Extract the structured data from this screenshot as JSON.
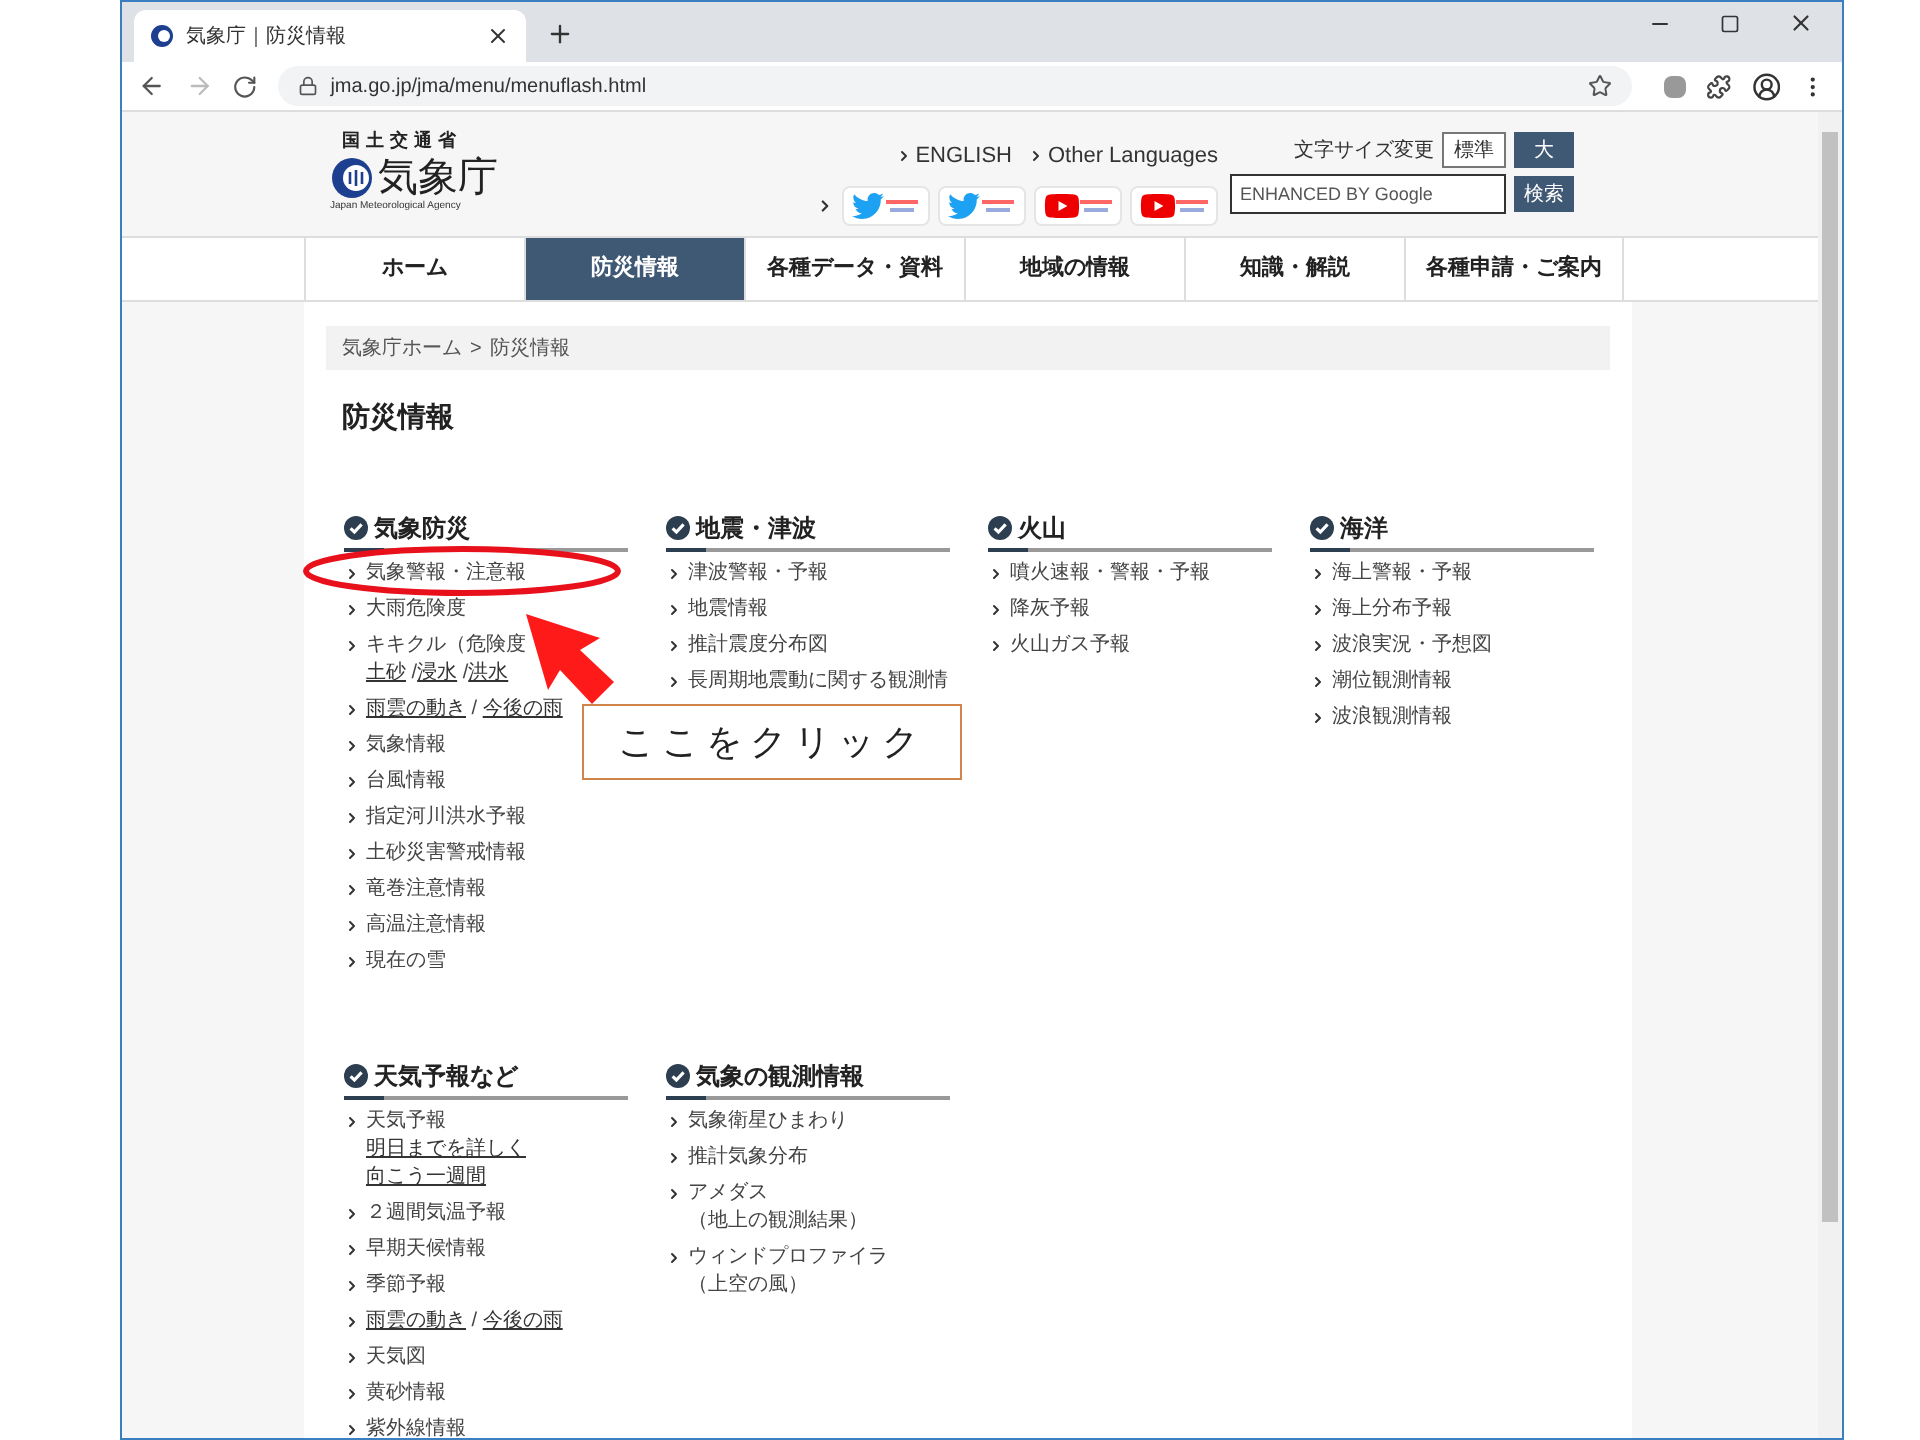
{
  "browser": {
    "tab_title": "気象庁｜防災情報",
    "url": "jma.go.jp/jma/menu/menuflash.html"
  },
  "header": {
    "ministry": "国土交通省",
    "logo": "気象庁",
    "logo_sub": "Japan Meteorological Agency",
    "lang_links": [
      "ENGLISH",
      "Other Languages"
    ],
    "social": [
      {
        "kind": "twitter"
      },
      {
        "kind": "twitter"
      },
      {
        "kind": "youtube"
      },
      {
        "kind": "youtube"
      }
    ],
    "font_size_label": "文字サイズ変更",
    "font_sizes": [
      {
        "label": "標準",
        "selected": false
      },
      {
        "label": "大",
        "selected": true
      }
    ],
    "search": {
      "placeholder": "ENHANCED BY Google",
      "button": "検索"
    }
  },
  "nav": [
    {
      "label": "ホーム",
      "selected": false
    },
    {
      "label": "防災情報",
      "selected": true
    },
    {
      "label": "各種データ・資料",
      "selected": false
    },
    {
      "label": "地域の情報",
      "selected": false
    },
    {
      "label": "知識・解説",
      "selected": false
    },
    {
      "label": "各種申請・ご案内",
      "selected": false
    }
  ],
  "breadcrumb": {
    "items": [
      "気象庁ホーム",
      "防災情報"
    ],
    "separator": ">"
  },
  "title": "防災情報",
  "section_rows": [
    [
      {
        "title": "気象防災",
        "items": [
          [
            [
              {
                "text": "気象警報・注意報"
              }
            ]
          ],
          [
            [
              {
                "text": "大雨危険度"
              }
            ]
          ],
          [
            [
              {
                "text": "キキクル（危険度"
              }
            ],
            [
              {
                "text": "土砂",
                "link": true
              },
              {
                "text": " /"
              },
              {
                "text": "浸水",
                "link": true
              },
              {
                "text": " /"
              },
              {
                "text": "洪水",
                "link": true
              }
            ]
          ],
          [
            [
              {
                "text": "雨雲の動き",
                "link": true
              },
              {
                "text": " / "
              },
              {
                "text": "今後の雨",
                "link": true
              }
            ]
          ],
          [
            [
              {
                "text": "気象情報"
              }
            ]
          ],
          [
            [
              {
                "text": "台風情報"
              }
            ]
          ],
          [
            [
              {
                "text": "指定河川洪水予報"
              }
            ]
          ],
          [
            [
              {
                "text": "土砂災害警戒情報"
              }
            ]
          ],
          [
            [
              {
                "text": "竜巻注意情報"
              }
            ]
          ],
          [
            [
              {
                "text": "高温注意情報"
              }
            ]
          ],
          [
            [
              {
                "text": "現在の雪"
              }
            ]
          ]
        ]
      },
      {
        "title": "地震・津波",
        "items": [
          [
            [
              {
                "text": "津波警報・予報"
              }
            ]
          ],
          [
            [
              {
                "text": "地震情報"
              }
            ]
          ],
          [
            [
              {
                "text": "推計震度分布図"
              }
            ]
          ],
          [
            [
              {
                "text": "長周期地震動に関する観測情"
              }
            ]
          ]
        ]
      },
      {
        "title": "火山",
        "items": [
          [
            [
              {
                "text": "噴火速報・警報・予報"
              }
            ]
          ],
          [
            [
              {
                "text": "降灰予報"
              }
            ]
          ],
          [
            [
              {
                "text": "火山ガス予報"
              }
            ]
          ]
        ]
      },
      {
        "title": "海洋",
        "items": [
          [
            [
              {
                "text": "海上警報・予報"
              }
            ]
          ],
          [
            [
              {
                "text": "海上分布予報"
              }
            ]
          ],
          [
            [
              {
                "text": "波浪実況・予想図"
              }
            ]
          ],
          [
            [
              {
                "text": "潮位観測情報"
              }
            ]
          ],
          [
            [
              {
                "text": "波浪観測情報"
              }
            ]
          ]
        ]
      }
    ],
    [
      {
        "title": "天気予報など",
        "items": [
          [
            [
              {
                "text": "天気予報"
              }
            ],
            [
              {
                "text": "明日までを詳しく",
                "link": true
              }
            ],
            [
              {
                "text": "向こう一週間",
                "link": true
              }
            ]
          ],
          [
            [
              {
                "text": "２週間気温予報"
              }
            ]
          ],
          [
            [
              {
                "text": "早期天候情報"
              }
            ]
          ],
          [
            [
              {
                "text": "季節予報"
              }
            ]
          ],
          [
            [
              {
                "text": "雨雲の動き",
                "link": true
              },
              {
                "text": " / "
              },
              {
                "text": "今後の雨",
                "link": true
              }
            ]
          ],
          [
            [
              {
                "text": "天気図"
              }
            ]
          ],
          [
            [
              {
                "text": "黄砂情報"
              }
            ]
          ],
          [
            [
              {
                "text": "紫外線情報"
              }
            ]
          ]
        ]
      },
      {
        "title": "気象の観測情報",
        "items": [
          [
            [
              {
                "text": "気象衛星ひまわり"
              }
            ]
          ],
          [
            [
              {
                "text": "推計気象分布"
              }
            ]
          ],
          [
            [
              {
                "text": "アメダス"
              }
            ],
            [
              {
                "text": "（地上の観測結果）"
              }
            ]
          ],
          [
            [
              {
                "text": "ウィンドプロファイラ"
              }
            ],
            [
              {
                "text": "（上空の風）"
              }
            ]
          ]
        ]
      }
    ]
  ],
  "annotation": {
    "callout": "ここをクリック"
  }
}
